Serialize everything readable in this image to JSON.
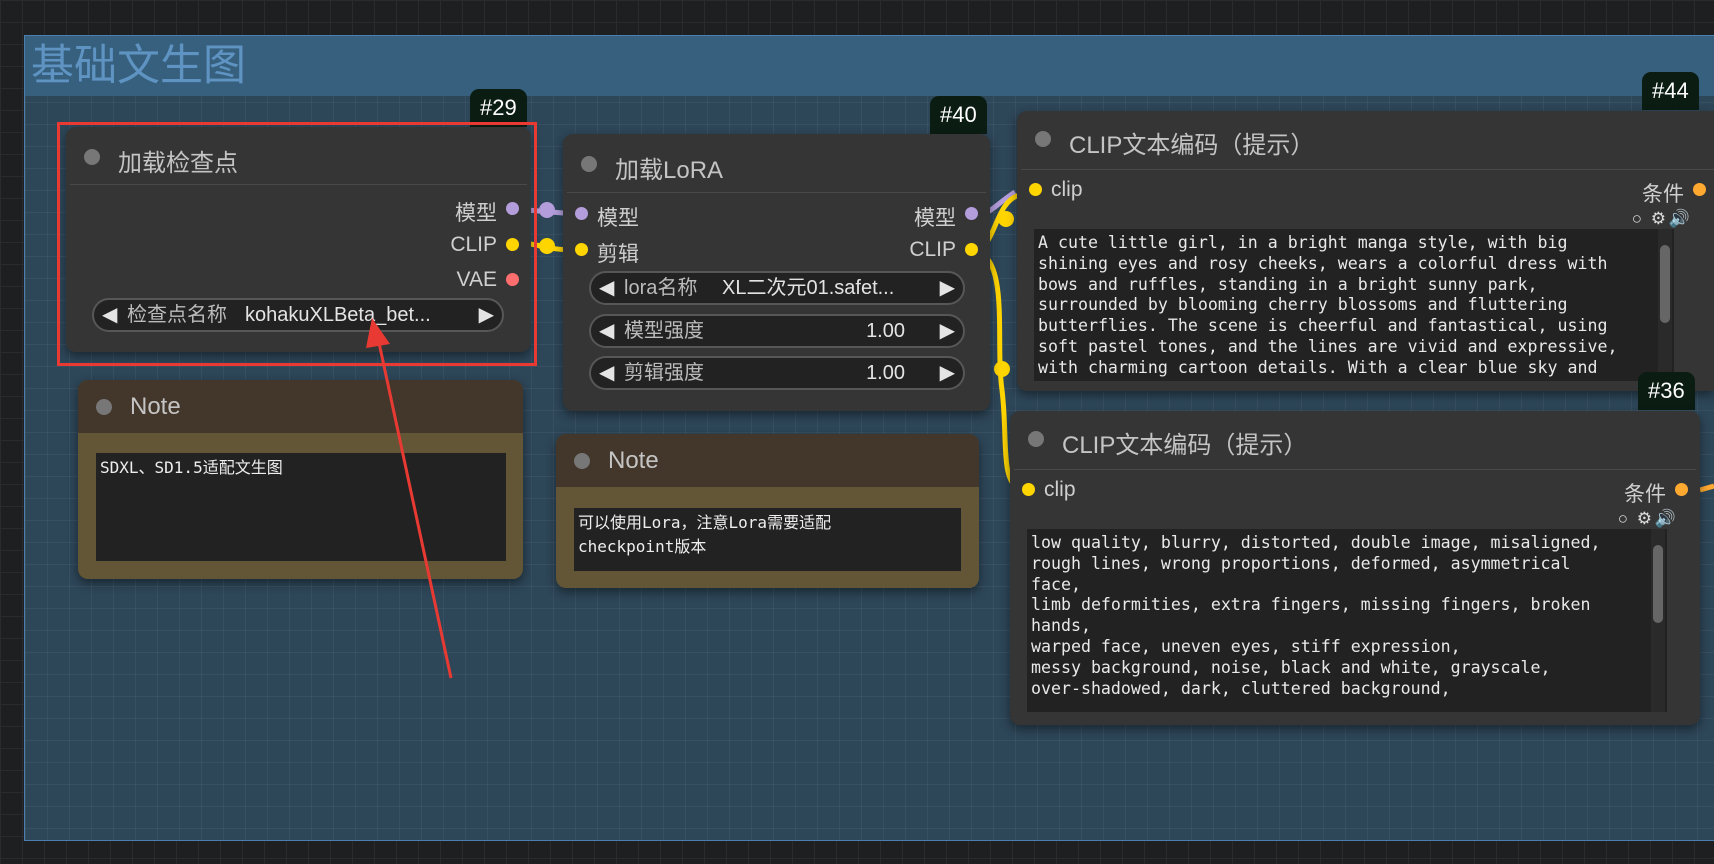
{
  "group": {
    "title": "基础文生图"
  },
  "checkpoint_node": {
    "id_badge": "#29",
    "title": "加载检查点",
    "outputs": [
      "模型",
      "CLIP",
      "VAE"
    ],
    "widget": {
      "name": "检查点名称",
      "value": "kohakuXLBeta_bet..."
    }
  },
  "lora_node": {
    "id_badge": "#40",
    "title": "加载LoRA",
    "inputs": [
      "模型",
      "剪辑"
    ],
    "outputs": [
      "模型",
      "CLIP"
    ],
    "widgets": [
      {
        "name": "lora名称",
        "value": "XL二次元01.safet..."
      },
      {
        "name": "模型强度",
        "value": "1.00"
      },
      {
        "name": "剪辑强度",
        "value": "1.00"
      }
    ]
  },
  "note_1": {
    "title": "Note",
    "text": "SDXL、SD1.5适配文生图"
  },
  "note_2": {
    "title": "Note",
    "text": "可以使用Lora，注意Lora需要适配\ncheckpoint版本"
  },
  "clip_positive": {
    "id_badge": "#44",
    "title": "CLIP文本编码（提示）",
    "input": "clip",
    "output": "条件",
    "text": "A cute little girl, in a bright manga style, with big\nshining eyes and rosy cheeks, wears a colorful dress with\nbows and ruffles, standing in a bright sunny park,\nsurrounded by blooming cherry blossoms and fluttering\nbutterflies. The scene is cheerful and fantastical, using\nsoft pastel tones, and the lines are vivid and expressive,\nwith charming cartoon details. With a clear blue sky and"
  },
  "clip_negative": {
    "id_badge": "#36",
    "title": "CLIP文本编码（提示）",
    "input": "clip",
    "output": "条件",
    "text": "low quality, blurry, distorted, double image, misaligned,\nrough lines, wrong proportions, deformed, asymmetrical\nface,\nlimb deformities, extra fingers, missing fingers, broken\nhands,\nwarped face, uneven eyes, stiff expression,\nmessy background, noise, black and white, grayscale,\nover-shadowed, dark, cluttered background,"
  },
  "icons": [
    "circle-icon",
    "gear-icon",
    "speaker-icon",
    "left-arrow-icon",
    "right-arrow-icon"
  ],
  "colors": {
    "model_slot": "#b39ddb",
    "clip_slot": "#ffd500",
    "vae_slot": "#ff6e6e",
    "conditioning_slot": "#ffa931",
    "highlight_box": "#e83a33",
    "group_header": "#37607f"
  }
}
